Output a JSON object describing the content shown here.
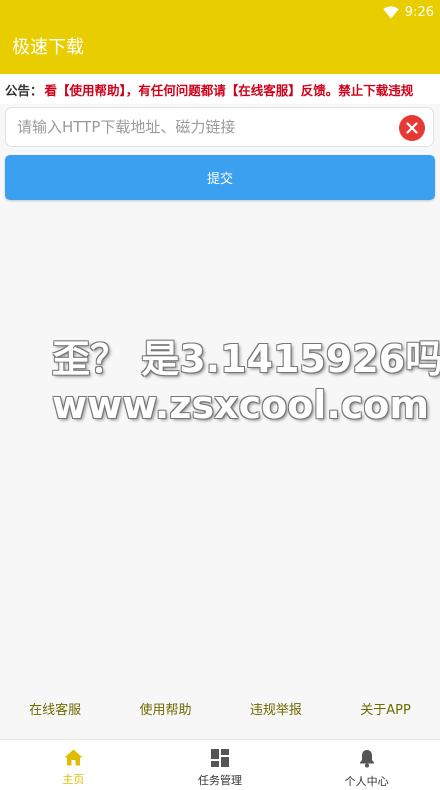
{
  "status_bar": {
    "time": "9:26"
  },
  "app": {
    "title": "极速下载"
  },
  "notice": {
    "label": "公告：",
    "text": "看【使用帮助】，有任何问题都请【在线客服】反馈。禁止下载违规"
  },
  "url_field": {
    "placeholder": "请输入HTTP下载地址、磁力链接",
    "value": ""
  },
  "submit_label": "提交",
  "watermark": {
    "line1": "歪？ 是3.1415926吗",
    "line2": "www.zsxcool.com"
  },
  "links": [
    {
      "label": "在线客服"
    },
    {
      "label": "使用帮助"
    },
    {
      "label": "违规举报"
    },
    {
      "label": "关于APP"
    }
  ],
  "nav": [
    {
      "label": "主页",
      "icon": "home-icon",
      "active": true
    },
    {
      "label": "任务管理",
      "icon": "dashboard-icon",
      "active": false
    },
    {
      "label": "个人中心",
      "icon": "bell-icon",
      "active": false
    }
  ],
  "colors": {
    "header": "#e8cd00",
    "submit": "#3ca0f0",
    "notice_text": "#d0021b",
    "clear_button": "#e53935",
    "nav_active": "#e0bd00",
    "link": "#6e6a00"
  }
}
